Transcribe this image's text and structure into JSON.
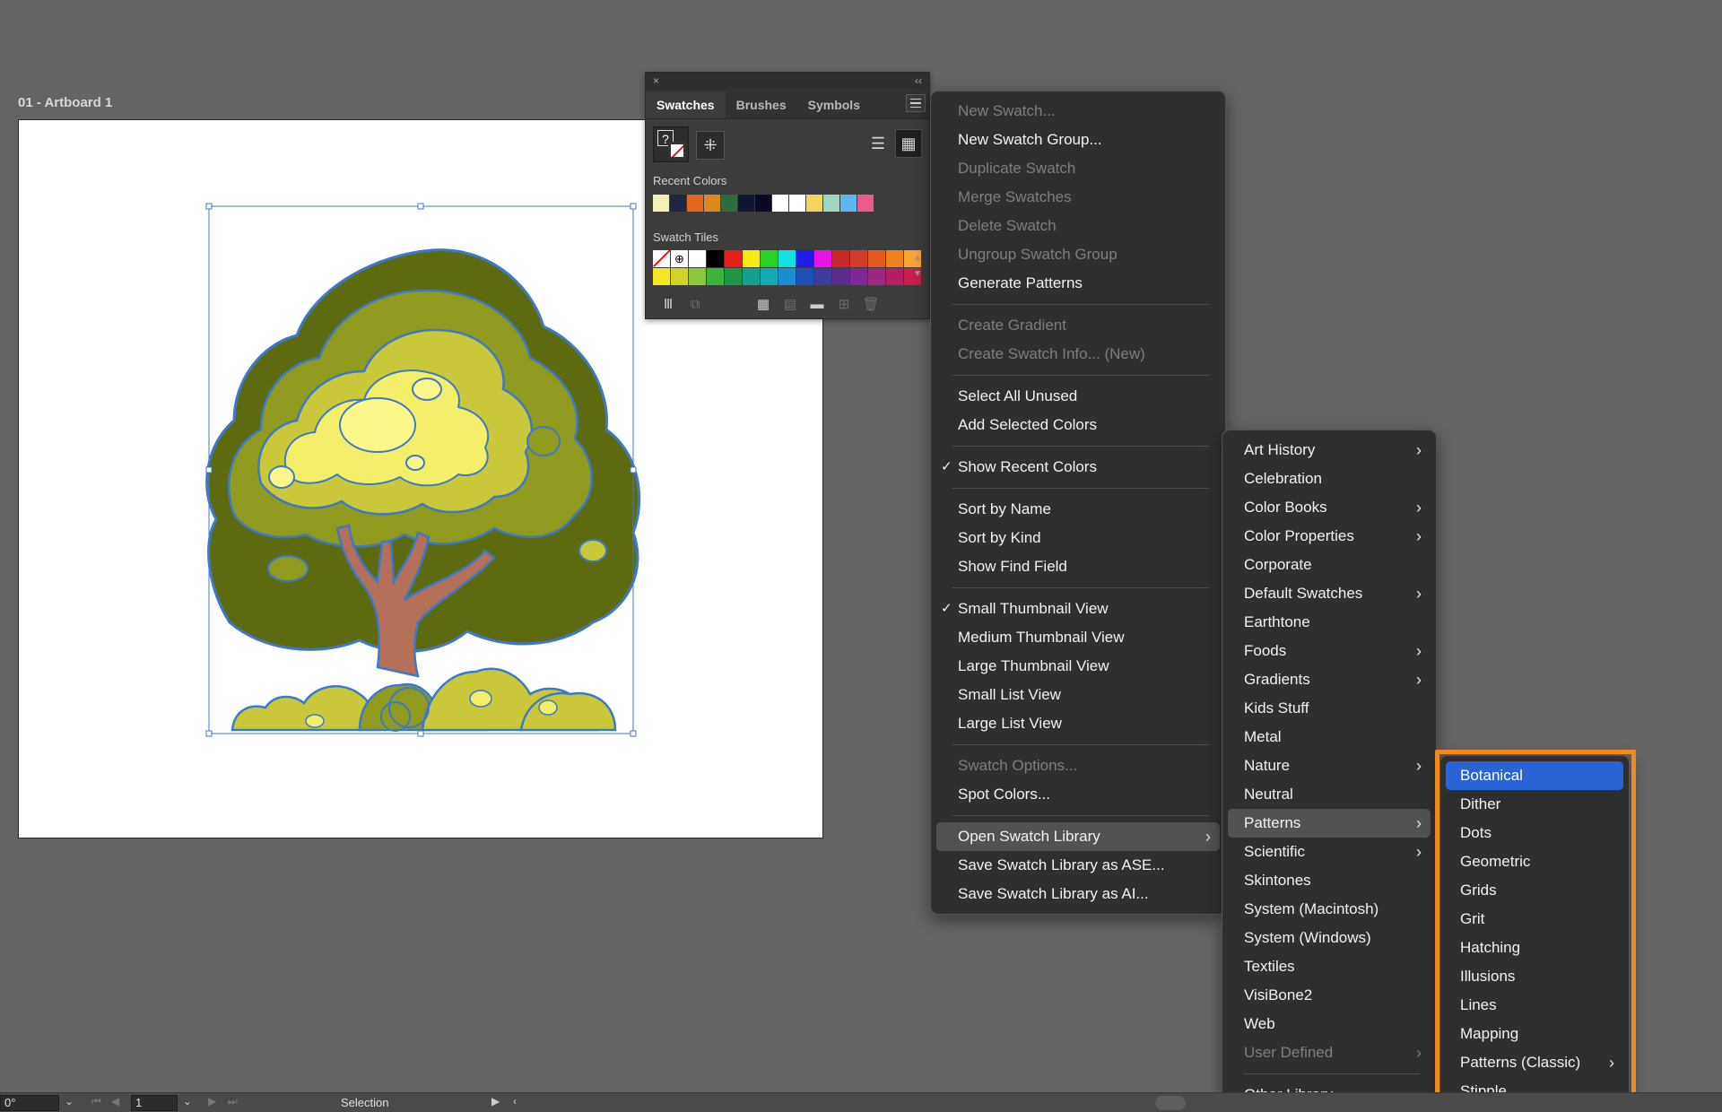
{
  "artboard": {
    "label": "01 - Artboard 1"
  },
  "swatches_panel": {
    "close_glyph": "×",
    "collapse_glyph": "‹‹",
    "tabs": [
      "Swatches",
      "Brushes",
      "Symbols"
    ],
    "fill_glyph": "?",
    "recent_label": "Recent Colors",
    "tiles_label": "Swatch Tiles",
    "recent_colors": [
      "#f5f0b8",
      "#1f2640",
      "#e5671b",
      "#d98a1e",
      "#2e6b3e",
      "#0e1630",
      "#0a0a24",
      "#ffffff",
      "#ffffff",
      "#f2d55e",
      "#9ed6c3",
      "#5bb8e8",
      "#e85b8a"
    ],
    "tile_colors": [
      "none",
      "registration",
      "#ffffff",
      "#000000",
      "#e61e1e",
      "#f5ea14",
      "#28d228",
      "#14e1e1",
      "#1e1ee6",
      "#e614e6",
      "#c82828",
      "#d23c28",
      "#e65a1e",
      "#f0821e",
      "#f5a532",
      "#f5e628",
      "#d2d228",
      "#8cc83c",
      "#3cb43c",
      "#1e9646",
      "#14a08c",
      "#14aab4",
      "#1e8cd2",
      "#1e50b4",
      "#3c3c9b",
      "#5a2d8c",
      "#7d2896",
      "#9b2882",
      "#b41e64",
      "#c81e4b"
    ],
    "bottom_icons": [
      "library-icon",
      "swatch-kind-icon",
      "grid-icon",
      "group-icon",
      "folder-icon",
      "new-swatch-icon",
      "trash-icon"
    ]
  },
  "main_menu": {
    "items": [
      {
        "label": "New Swatch...",
        "disabled": true
      },
      {
        "label": "New Swatch Group...",
        "disabled": false
      },
      {
        "label": "Duplicate Swatch",
        "disabled": true
      },
      {
        "label": "Merge Swatches",
        "disabled": true
      },
      {
        "label": "Delete Swatch",
        "disabled": true
      },
      {
        "label": "Ungroup Swatch Group",
        "disabled": true
      },
      {
        "label": "Generate Patterns",
        "disabled": false
      },
      {
        "sep": true
      },
      {
        "label": "Create Gradient",
        "disabled": true
      },
      {
        "label": "Create Swatch Info... (New)",
        "disabled": true
      },
      {
        "sep": true
      },
      {
        "label": "Select All Unused",
        "disabled": false
      },
      {
        "label": "Add Selected Colors",
        "disabled": false
      },
      {
        "sep": true
      },
      {
        "label": "Show Recent Colors",
        "disabled": false,
        "checked": true
      },
      {
        "sep": true
      },
      {
        "label": "Sort by Name",
        "disabled": false
      },
      {
        "label": "Sort by Kind",
        "disabled": false
      },
      {
        "label": "Show Find Field",
        "disabled": false
      },
      {
        "sep": true
      },
      {
        "label": "Small Thumbnail View",
        "disabled": false,
        "checked": true
      },
      {
        "label": "Medium Thumbnail View",
        "disabled": false
      },
      {
        "label": "Large Thumbnail View",
        "disabled": false
      },
      {
        "label": "Small List View",
        "disabled": false
      },
      {
        "label": "Large List View",
        "disabled": false
      },
      {
        "sep": true
      },
      {
        "label": "Swatch Options...",
        "disabled": true
      },
      {
        "label": "Spot Colors...",
        "disabled": false
      },
      {
        "sep": true
      },
      {
        "label": "Open Swatch Library",
        "disabled": false,
        "submenu": true,
        "hover": true
      },
      {
        "label": "Save Swatch Library as ASE...",
        "disabled": false
      },
      {
        "label": "Save Swatch Library as AI...",
        "disabled": false
      }
    ]
  },
  "library_menu": {
    "items": [
      {
        "label": "Art History",
        "submenu": true
      },
      {
        "label": "Celebration"
      },
      {
        "label": "Color Books",
        "submenu": true
      },
      {
        "label": "Color Properties",
        "submenu": true
      },
      {
        "label": "Corporate"
      },
      {
        "label": "Default Swatches",
        "submenu": true
      },
      {
        "label": "Earthtone"
      },
      {
        "label": "Foods",
        "submenu": true
      },
      {
        "label": "Gradients",
        "submenu": true
      },
      {
        "label": "Kids Stuff"
      },
      {
        "label": "Metal"
      },
      {
        "label": "Nature",
        "submenu": true
      },
      {
        "label": "Neutral"
      },
      {
        "label": "Patterns",
        "submenu": true,
        "hover": true
      },
      {
        "label": "Scientific",
        "submenu": true
      },
      {
        "label": "Skintones"
      },
      {
        "label": "System (Macintosh)"
      },
      {
        "label": "System (Windows)"
      },
      {
        "label": "Textiles"
      },
      {
        "label": "VisiBone2"
      },
      {
        "label": "Web"
      },
      {
        "label": "User Defined",
        "submenu": true,
        "disabled": true
      },
      {
        "sep": true
      },
      {
        "label": "Other Library..."
      }
    ]
  },
  "patterns_menu": {
    "items": [
      {
        "label": "Botanical",
        "selected": true
      },
      {
        "label": "Dither"
      },
      {
        "label": "Dots"
      },
      {
        "label": "Geometric"
      },
      {
        "label": "Grids"
      },
      {
        "label": "Grit"
      },
      {
        "label": "Hatching"
      },
      {
        "label": "Illusions"
      },
      {
        "label": "Lines"
      },
      {
        "label": "Mapping"
      },
      {
        "label": "Patterns (Classic)",
        "submenu": true
      },
      {
        "label": "Stipple"
      }
    ]
  },
  "statusbar": {
    "rotation": "0°",
    "artboard_number": "1",
    "tool": "Selection"
  },
  "colors": {
    "highlight": "#f08a1c",
    "selection_blue": "#2a64d4",
    "tree_dark": "#5e6a10",
    "tree_mid": "#8f9a1f",
    "tree_light": "#c8c83a",
    "tree_pale": "#f4ef6a",
    "trunk": "#b5705a",
    "outline": "#3f78c8"
  }
}
